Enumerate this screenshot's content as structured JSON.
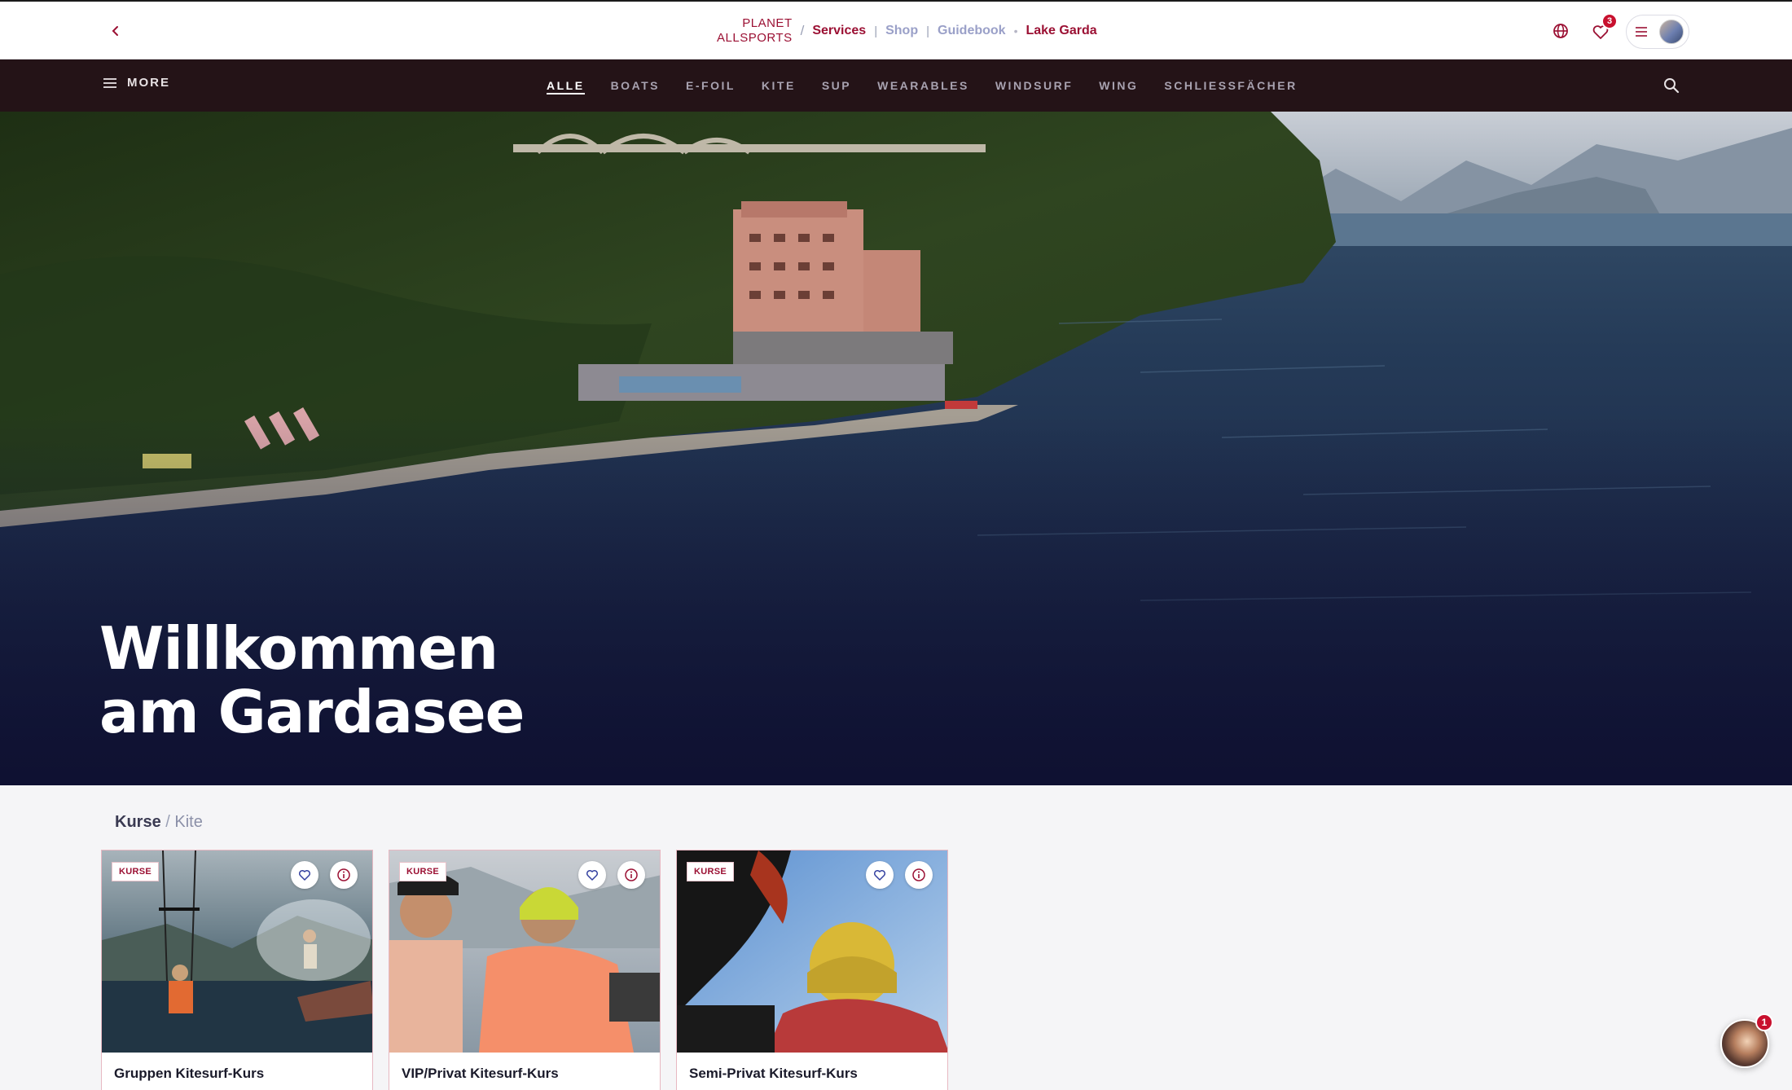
{
  "header": {
    "back_icon": "chevron-left-icon",
    "logo_line1": "PLANET",
    "logo_line2": "ALLSPORTS",
    "crumb_separator": "/",
    "breadcrumbs": [
      {
        "label": "Services",
        "active": true
      },
      {
        "label": "Shop",
        "active": false
      },
      {
        "label": "Guidebook",
        "active": false
      }
    ],
    "location": "Lake Garda",
    "favorites_count": "3",
    "icons": [
      "globe-icon",
      "heart-icon",
      "menu-icon"
    ]
  },
  "nav": {
    "more_label": "MORE",
    "items": [
      "ALLE",
      "BOATS",
      "E-FOIL",
      "KITE",
      "SUP",
      "WEARABLES",
      "WINDSURF",
      "WING",
      "SCHLIESSFÄCHER"
    ],
    "active_index": 0
  },
  "hero": {
    "title_line1": "Willkommen",
    "title_line2": "am Gardasee"
  },
  "section": {
    "crumb_main": "Kurse",
    "crumb_separator": "/",
    "crumb_sub": "Kite"
  },
  "cards": [
    {
      "tag": "KURSE",
      "title": "Gruppen Kitesurf-Kurs"
    },
    {
      "tag": "KURSE",
      "title": "VIP/Privat Kitesurf-Kurs"
    },
    {
      "tag": "KURSE",
      "title": "Semi-Privat Kitesurf-Kurs"
    }
  ],
  "chat": {
    "badge": "1"
  },
  "colors": {
    "brand": "#9b1033",
    "nav_bg": "#241317",
    "badge": "#c8102e"
  }
}
